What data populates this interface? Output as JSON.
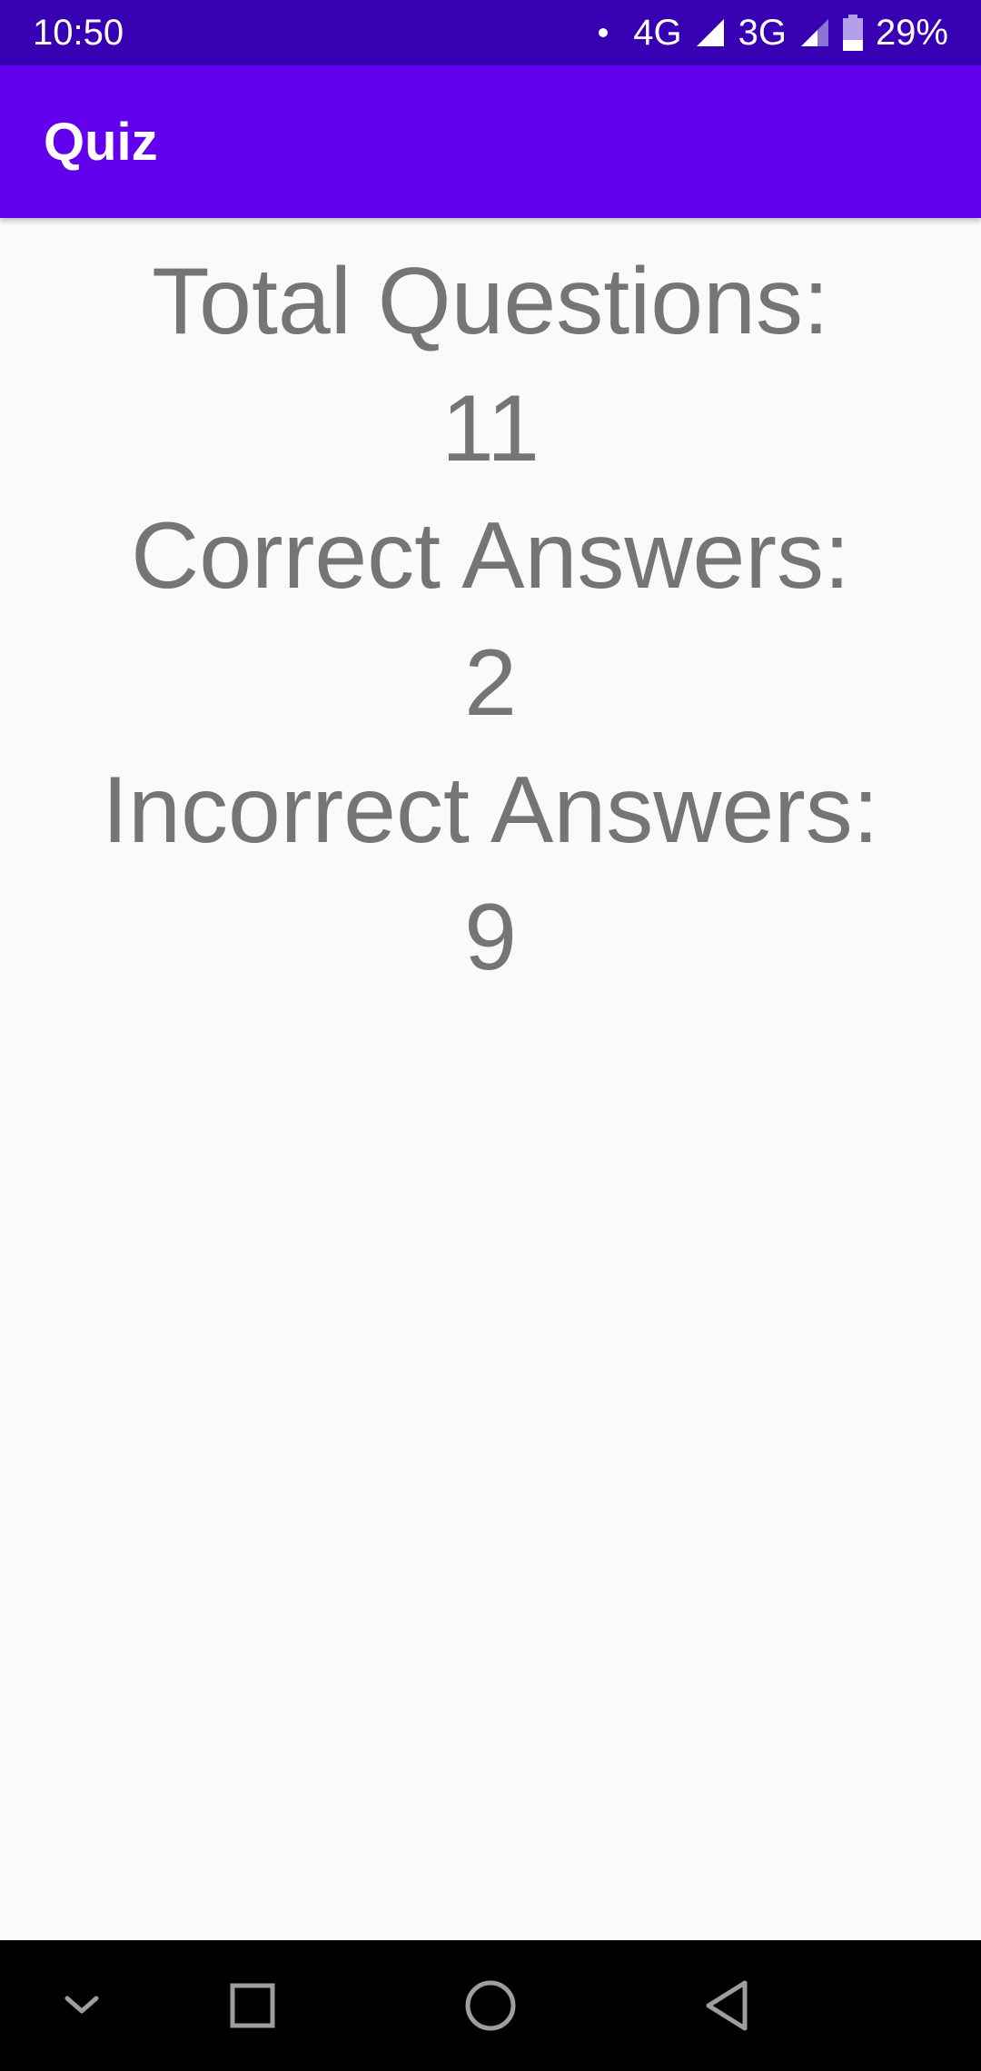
{
  "status_bar": {
    "time": "10:50",
    "network_1": "4G",
    "network_2": "3G",
    "battery": "29%"
  },
  "app_bar": {
    "title": "Quiz"
  },
  "results": {
    "total_label": "Total Questions:",
    "total_value": "11",
    "correct_label": "Correct Answers:",
    "correct_value": "2",
    "incorrect_label": "Incorrect Answers:",
    "incorrect_value": "9"
  },
  "nav_bar": {
    "icons": [
      "chevron-down-icon",
      "recents-icon",
      "home-icon",
      "back-icon"
    ]
  },
  "colors": {
    "status_bar": "#3700b3",
    "app_bar": "#6200ee",
    "text": "#757575",
    "background": "#fafafa"
  }
}
